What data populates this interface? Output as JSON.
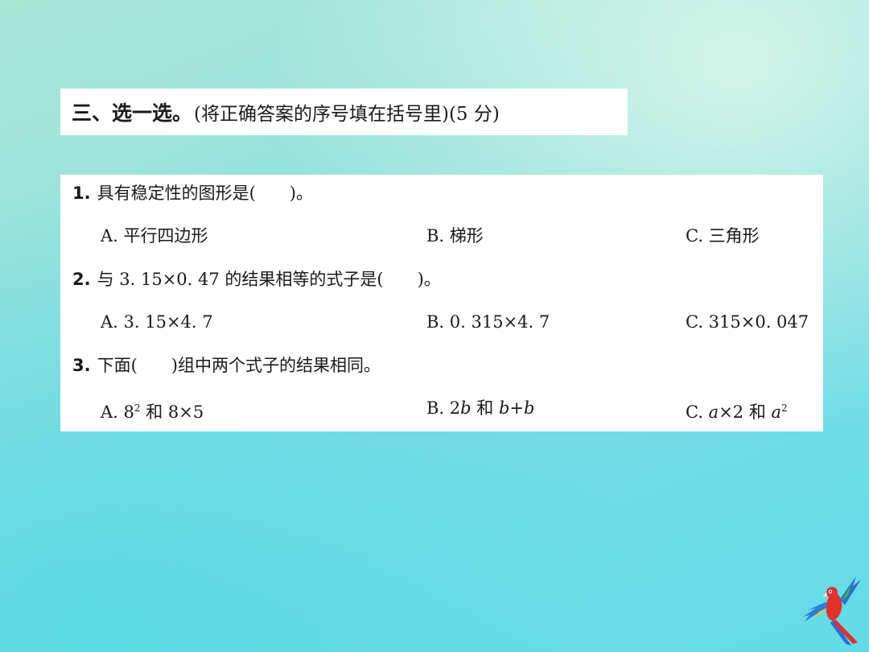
{
  "section": {
    "title": "三、选一选。",
    "instruction": "(将正确答案的序号填在括号里)(5 分)"
  },
  "questions": [
    {
      "number": "1.",
      "text": "具有稳定性的图形是(　　)。",
      "options": {
        "a": "A. 平行四边形",
        "b": "B. 梯形",
        "c": "C. 三角形"
      }
    },
    {
      "number": "2.",
      "text": "与 3. 15×0. 47 的结果相等的式子是(　　)。",
      "options": {
        "a": "A. 3. 15×4. 7",
        "b": "B. 0. 315×4. 7",
        "c": "C. 315×0. 047"
      }
    },
    {
      "number": "3.",
      "text": "下面(　　)组中两个式子的结果相同。",
      "options": {
        "a_prefix": "A. 8",
        "a_sup": "2",
        "a_suffix": " 和 8×5",
        "b_prefix": "B. 2",
        "b_var1": "b",
        "b_mid": " 和 ",
        "b_var2": "b",
        "b_op": "+",
        "b_var3": "b",
        "c_prefix": "C. ",
        "c_var1": "a",
        "c_mid": "×2 和 ",
        "c_var2": "a",
        "c_sup": "2"
      }
    }
  ],
  "decoration": {
    "logo": "parrot-icon",
    "colors": {
      "header_bg": "#ffffff",
      "card_bg": "#ffffff",
      "background_start": "#a8e6d6",
      "background_end": "#64dbe8"
    }
  }
}
